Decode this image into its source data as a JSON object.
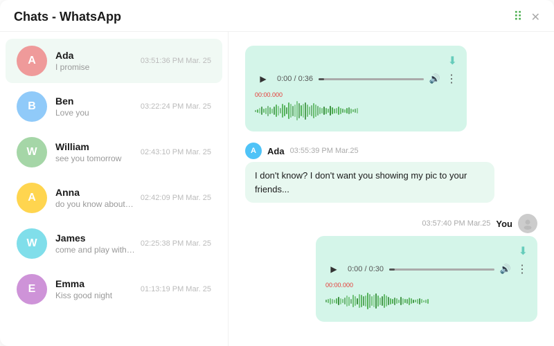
{
  "titleBar": {
    "title": "Chats - WhatsApp",
    "closeLabel": "✕",
    "gridLabel": "⠿"
  },
  "sidebar": {
    "contacts": [
      {
        "id": "ada",
        "name": "Ada",
        "preview": "I promise",
        "time": "03:51:36 PM Mar. 25",
        "avatarColor": "#EF9A9A",
        "letter": "A",
        "active": true
      },
      {
        "id": "ben",
        "name": "Ben",
        "preview": "Love you",
        "time": "03:22:24 PM Mar. 25",
        "avatarColor": "#90CAF9",
        "letter": "B",
        "active": false
      },
      {
        "id": "william",
        "name": "William",
        "preview": "see you tomorrow",
        "time": "02:43:10 PM Mar. 25",
        "avatarColor": "#A5D6A7",
        "letter": "W",
        "active": false
      },
      {
        "id": "anna",
        "name": "Anna",
        "preview": "do you know about that",
        "time": "02:42:09 PM Mar. 25",
        "avatarColor": "#FFD54F",
        "letter": "A",
        "active": false
      },
      {
        "id": "james",
        "name": "James",
        "preview": "come and play with me",
        "time": "02:25:38 PM Mar. 25",
        "avatarColor": "#80DEEA",
        "letter": "W",
        "active": false
      },
      {
        "id": "emma",
        "name": "Emma",
        "preview": "Kiss good night",
        "time": "01:13:19 PM Mar. 25",
        "avatarColor": "#CE93D8",
        "letter": "E",
        "active": false
      }
    ]
  },
  "chatPanel": {
    "incomingAudio1": {
      "time": "0:00",
      "duration": "0:36",
      "waveformData": [
        3,
        5,
        8,
        12,
        6,
        9,
        15,
        10,
        7,
        12,
        18,
        14,
        8,
        20,
        16,
        10,
        24,
        20,
        15,
        18,
        28,
        22,
        16,
        20,
        25,
        18,
        12,
        16,
        22,
        18,
        14,
        10,
        8,
        12,
        9,
        6,
        14,
        10,
        7,
        8,
        12,
        9,
        6,
        5,
        8,
        10,
        7,
        4,
        6,
        8
      ],
      "timestamp": "00:00.000"
    },
    "incomingMessage": {
      "senderInitial": "A",
      "senderName": "Ada",
      "time": "03:55:39 PM Mar.25",
      "text": "I don't know? I don't want you showing my pic to your friends..."
    },
    "outgoingAudio": {
      "time": "03:57:40 PM Mar.25",
      "senderLabel": "You",
      "audioTime": "0:00",
      "duration": "0:30",
      "waveformData": [
        4,
        6,
        9,
        7,
        5,
        8,
        12,
        9,
        6,
        10,
        16,
        13,
        7,
        18,
        14,
        9,
        20,
        18,
        14,
        16,
        24,
        20,
        14,
        18,
        22,
        16,
        11,
        14,
        20,
        16,
        12,
        9,
        7,
        11,
        8,
        5,
        12,
        9,
        6,
        7,
        11,
        8,
        5,
        4,
        7,
        9,
        6,
        3,
        5,
        7
      ],
      "timestamp": "00:00.000"
    }
  },
  "colors": {
    "audioBg": "#d4f5e9",
    "waveformGreen": "#4CAF50",
    "waveformDark": "#388E3C",
    "accentGreen": "#4CAF50",
    "avatarBlue": "#4FC3F7"
  }
}
